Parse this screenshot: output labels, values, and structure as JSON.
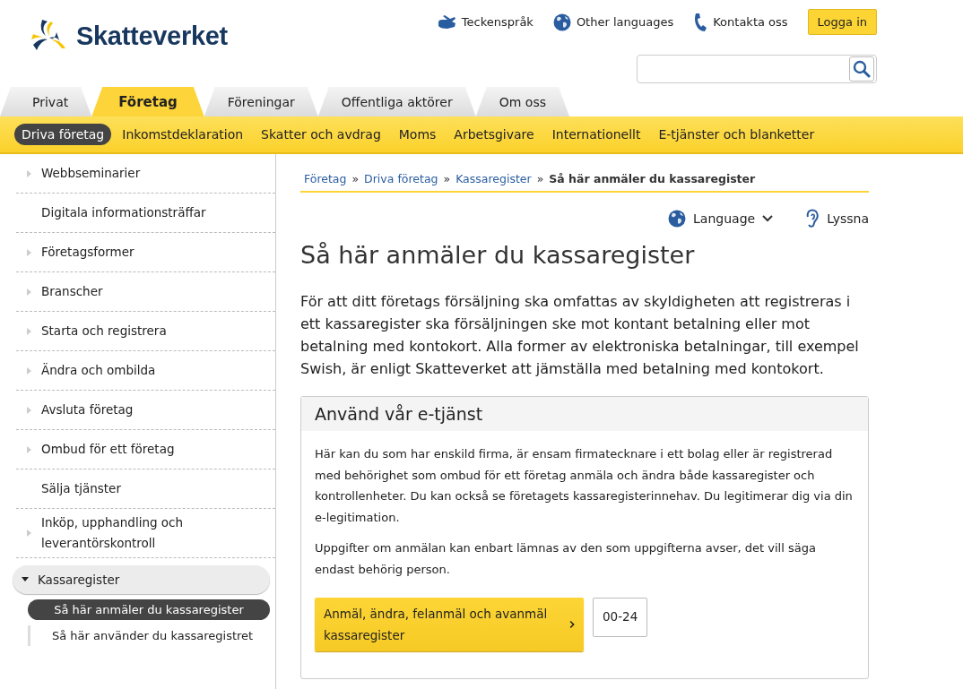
{
  "header": {
    "logo_text": "Skatteverket",
    "top_links": [
      {
        "kind": "sign",
        "label": "Teckenspråk"
      },
      {
        "kind": "globe",
        "label": "Other languages"
      },
      {
        "kind": "phone",
        "label": "Kontakta oss"
      }
    ],
    "login_button": "Logga in"
  },
  "main_tabs": [
    {
      "label": "Privat",
      "selected": false
    },
    {
      "label": "Företag",
      "selected": true
    },
    {
      "label": "Föreningar",
      "selected": false
    },
    {
      "label": "Offentliga aktörer",
      "selected": false
    },
    {
      "label": "Om oss",
      "selected": false
    }
  ],
  "sub_nav": [
    {
      "label": "Driva företag",
      "selected": true
    },
    {
      "label": "Inkomstdeklaration",
      "selected": false
    },
    {
      "label": "Skatter och avdrag",
      "selected": false
    },
    {
      "label": "Moms",
      "selected": false
    },
    {
      "label": "Arbetsgivare",
      "selected": false
    },
    {
      "label": "Internationellt",
      "selected": false
    },
    {
      "label": "E-tjänster och blanketter",
      "selected": false
    }
  ],
  "sidebar": {
    "items": [
      {
        "kind": "section",
        "label": "Webbseminarier",
        "expanded": false
      },
      {
        "kind": "page",
        "label": "Digitala informationsträffar"
      },
      {
        "kind": "section",
        "label": "Företagsformer",
        "expanded": false
      },
      {
        "kind": "section",
        "label": "Branscher",
        "expanded": false
      },
      {
        "kind": "section",
        "label": "Starta och registrera",
        "expanded": false
      },
      {
        "kind": "section",
        "label": "Ändra och ombilda",
        "expanded": false
      },
      {
        "kind": "section",
        "label": "Avsluta företag",
        "expanded": false
      },
      {
        "kind": "section",
        "label": "Ombud för ett företag",
        "expanded": false
      },
      {
        "kind": "page",
        "label": "Sälja tjänster"
      },
      {
        "kind": "section",
        "label": "Inköp, upphandling och leverantörskontroll",
        "expanded": false
      },
      {
        "kind": "section",
        "label": "Kassaregister",
        "expanded": true,
        "children": [
          {
            "label": "Så här anmäler du kassaregister",
            "selected": true
          },
          {
            "label": "Så här använder du kassaregistret",
            "selected": false
          }
        ]
      }
    ]
  },
  "breadcrumb": [
    {
      "label": "Företag",
      "kind": "link"
    },
    {
      "separator": "»",
      "label": "Driva företag",
      "kind": "link"
    },
    {
      "separator": "»",
      "label": "Kassaregister",
      "kind": "link"
    },
    {
      "separator": "»",
      "label": "Så här anmäler du kassaregister",
      "kind": "current"
    }
  ],
  "tools": {
    "language": "Language",
    "listen": "Lyssna"
  },
  "title": "Så här anmäler du kassaregister",
  "intro": "För att ditt företags försäljning ska omfattas av skyldigheten att registreras i ett kassaregister ska försäljningen ske mot kontant betalning eller mot betalning med kontokort. Alla former av elektroniska betalningar, till exempel Swish, är enligt Skatteverket att jämställa med betalning med kontokort.",
  "service_box": {
    "heading": "Använd vår e-tjänst",
    "paragraphs": [
      "Här kan du som har enskild firma, är ensam firmatecknare i ett bolag eller är registrerad med behörighet som ombud för ett företag anmäla och ändra både kassaregister och kontrollenheter. Du kan också se företagets kassaregisterinnehav. Du legitimerar dig via din e-legitimation.",
      "Uppgifter om anmälan kan enbart lämnas av den som uppgifterna avser, det vill säga endast behörig person."
    ],
    "button": "Anmäl, ändra, felanmäl och avanmäl kassaregister",
    "hours": "00-24"
  }
}
